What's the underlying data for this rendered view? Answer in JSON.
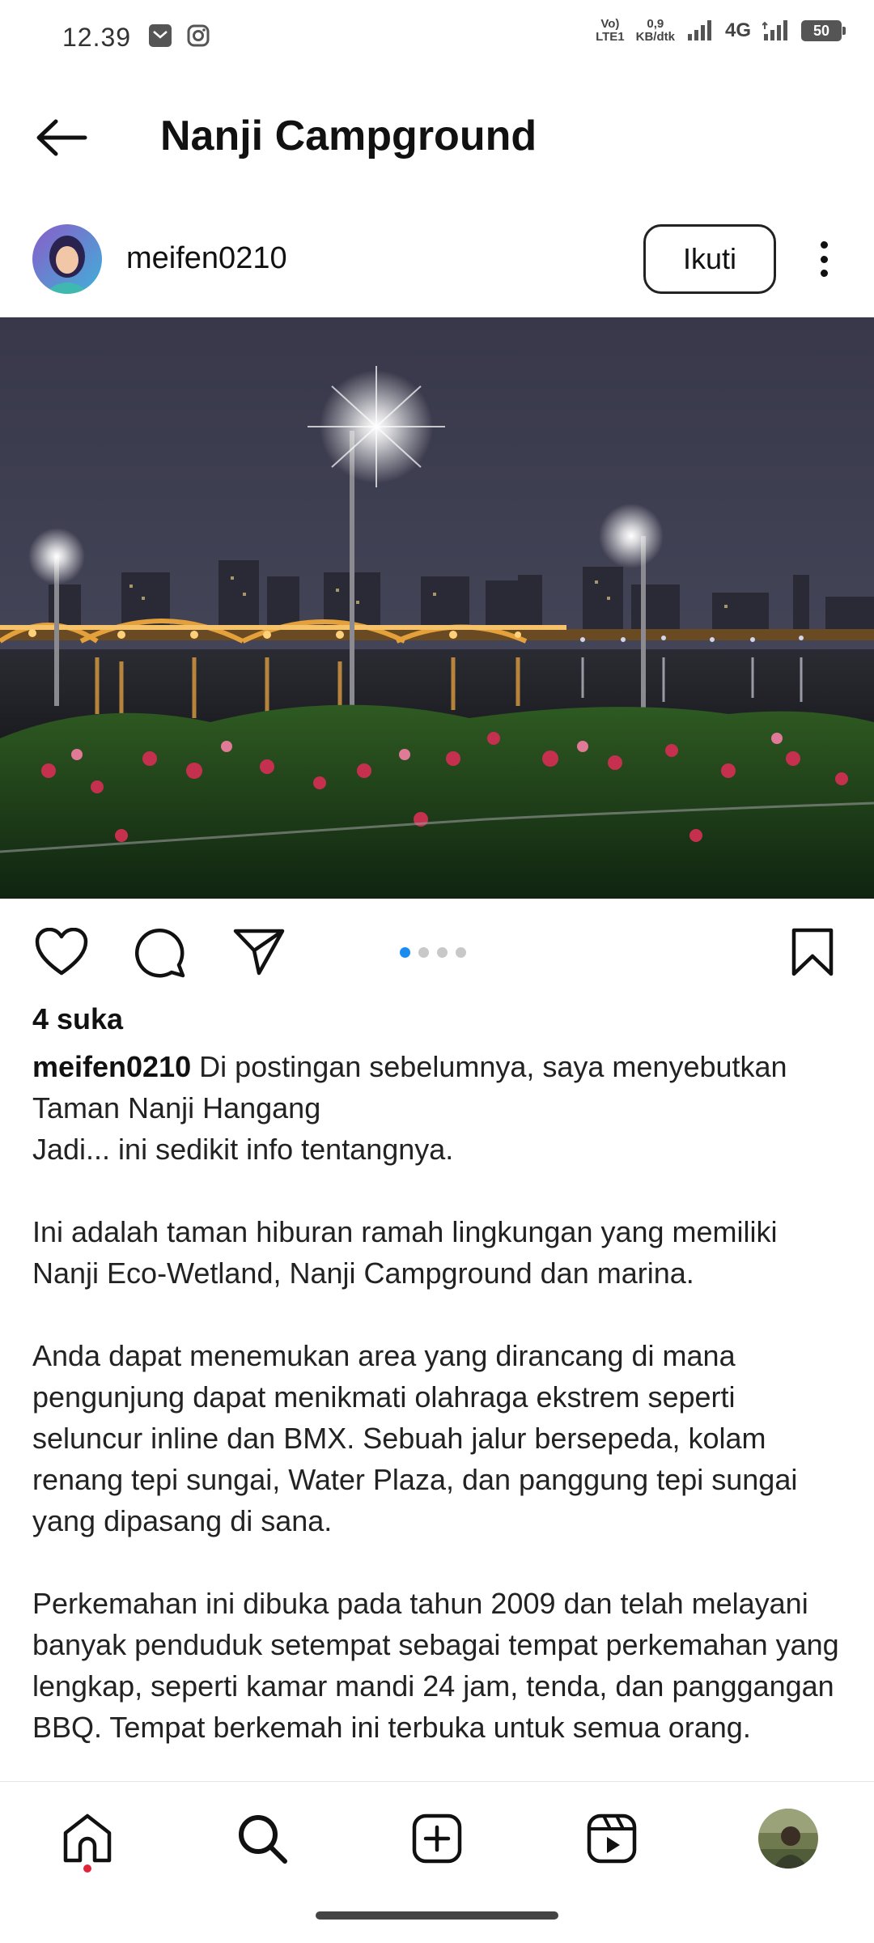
{
  "status_bar": {
    "time": "12.39",
    "network_label_1": "Vo)",
    "network_label_2": "LTE1",
    "speed_value": "0,9",
    "speed_unit": "KB/dtk",
    "network_type": "4G",
    "battery": "50",
    "icons": [
      "mail-icon",
      "instagram-icon",
      "signal-icon",
      "signal-icon"
    ]
  },
  "header": {
    "title": "Nanji Campground",
    "back_icon": "arrow-left-icon"
  },
  "post": {
    "username": "meifen0210",
    "follow_label": "Ikuti",
    "more_icon": "more-vertical-icon",
    "carousel": {
      "total": 4,
      "current": 1
    },
    "likes": "4 suka",
    "caption_user": "meifen0210",
    "caption_lines": [
      " Di postingan sebelumnya, saya menyebutkan Taman Nanji Hangang",
      "Jadi... ini sedikit info tentangnya.",
      "",
      "Ini adalah taman hiburan ramah lingkungan yang memiliki Nanji Eco-Wetland, Nanji Campground dan marina.",
      "",
      "Anda dapat menemukan area yang dirancang di mana pengunjung dapat menikmati olahraga ekstrem seperti seluncur inline dan BMX. Sebuah jalur bersepeda, kolam renang tepi sungai, Water Plaza, dan panggung tepi sungai yang dipasang di sana.",
      "",
      "Perkemahan ini dibuka pada tahun 2009 dan telah melayani banyak penduduk setempat sebagai tempat perkemahan yang lengkap, seperti kamar mandi 24 jam, tenda, dan panggangan BBQ. Tempat berkemah ini terbuka untuk semua orang."
    ]
  },
  "actions": {
    "icons": [
      "heart-icon",
      "comment-icon",
      "share-icon",
      "bookmark-icon"
    ]
  },
  "nav": {
    "icons": [
      "home-icon",
      "search-icon",
      "add-post-icon",
      "reels-icon",
      "profile-avatar"
    ]
  },
  "colors": {
    "accent_blue": "#1a8cf0",
    "notification_red": "#e0253b",
    "text": "#111111"
  }
}
